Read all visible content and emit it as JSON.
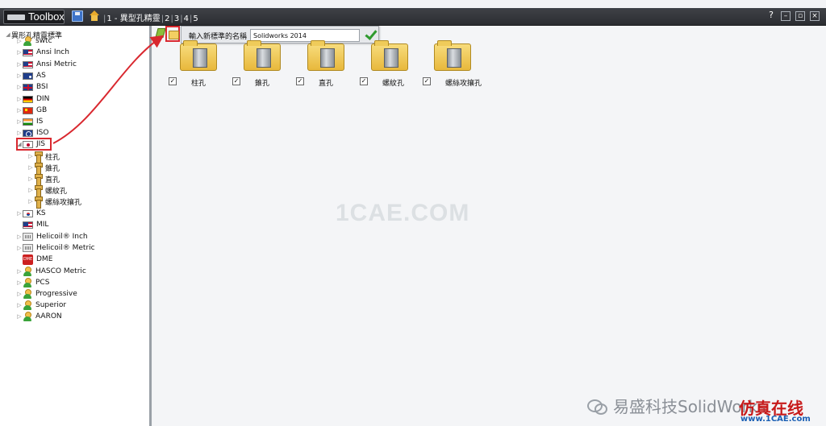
{
  "titlebar": {
    "app_title": "Toolbox",
    "breadcrumbs": [
      "1 - 異型孔精靈",
      "2",
      "3",
      "4",
      "5"
    ],
    "help": "?"
  },
  "tree": {
    "root": "異形孔精靈標準",
    "items": [
      {
        "label": "swtc",
        "icon": "person-icon"
      },
      {
        "label": "Ansi Inch",
        "icon": "us-flag-icon"
      },
      {
        "label": "Ansi Metric",
        "icon": "us-flag-icon"
      },
      {
        "label": "AS",
        "icon": "australia-flag-icon"
      },
      {
        "label": "BSI",
        "icon": "uk-flag-icon"
      },
      {
        "label": "DIN",
        "icon": "germany-flag-icon"
      },
      {
        "label": "GB",
        "icon": "china-flag-icon"
      },
      {
        "label": "IS",
        "icon": "india-flag-icon"
      },
      {
        "label": "ISO",
        "icon": "iso-flag-icon"
      },
      {
        "label": "JIS",
        "icon": "japan-flag-icon"
      }
    ],
    "jis_children": [
      "柱孔",
      "錐孔",
      "直孔",
      "螺紋孔",
      "螺絲攻攘孔"
    ],
    "items_after": [
      {
        "label": "KS",
        "icon": "korea-flag-icon"
      },
      {
        "label": "MIL",
        "icon": "us-flag-icon"
      },
      {
        "label": "Helicoil® Inch",
        "icon": "folder-icon"
      },
      {
        "label": "Helicoil® Metric",
        "icon": "folder-icon"
      },
      {
        "label": "DME",
        "icon": "dme-icon"
      },
      {
        "label": "HASCO Metric",
        "icon": "person-icon"
      },
      {
        "label": "PCS",
        "icon": "person-icon"
      },
      {
        "label": "Progressive",
        "icon": "person-icon"
      },
      {
        "label": "Superior",
        "icon": "person-icon"
      },
      {
        "label": "AARON",
        "icon": "person-icon"
      }
    ]
  },
  "new_standard": {
    "label": "輸入新標準的名稱",
    "value": "Solidworks 2014"
  },
  "hole_types": [
    {
      "name": "柱孔",
      "checked": true
    },
    {
      "name": "錐孔",
      "checked": true
    },
    {
      "name": "直孔",
      "checked": true
    },
    {
      "name": "螺紋孔",
      "checked": true
    },
    {
      "name": "螺絲攻攘孔",
      "checked": true
    }
  ],
  "watermark": "1CAE.COM",
  "footer": {
    "brand": "易盛科技SolidWorks",
    "logo_cn": "仿真在线",
    "logo_url": "www.1CAE.com"
  },
  "colors": {
    "highlight": "#d9282f",
    "titlebar": "#2b2d31",
    "accent_green": "#2e9a2e"
  }
}
